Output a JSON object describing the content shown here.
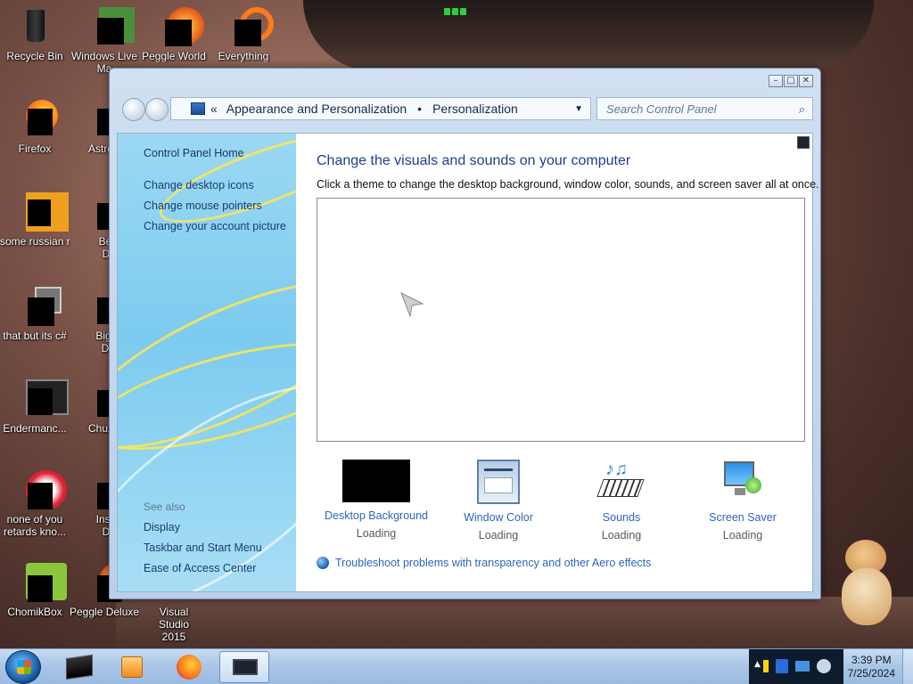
{
  "desktop": {
    "icons": [
      {
        "label": "Recycle Bin",
        "icon": "recycle-bin-icon"
      },
      {
        "label": "Windows Live Ma",
        "icon": "windows-live-icon"
      },
      {
        "label": "Peggle World",
        "icon": "peggle-world-icon"
      },
      {
        "label": "Everything",
        "icon": "everything-icon"
      },
      {
        "label": "Firefox",
        "icon": "firefox-icon"
      },
      {
        "label": "Astro Delu",
        "icon": "astro-icon"
      },
      {
        "label": "some russian ran a rat",
        "icon": "app-icon"
      },
      {
        "label": "Bejew Delu",
        "icon": "bejeweled-icon"
      },
      {
        "label": "that but its c#",
        "icon": "app-icon"
      },
      {
        "label": "Big Mo Delu",
        "icon": "app-icon"
      },
      {
        "label": "Endermanc...",
        "icon": "app-icon"
      },
      {
        "label": "Chuz Delu",
        "icon": "app-icon"
      },
      {
        "label": "none of you retards kno...",
        "icon": "app-icon"
      },
      {
        "label": "Insaniq Delu",
        "icon": "app-icon"
      },
      {
        "label": "ChomikBox",
        "icon": "chomikbox-icon"
      },
      {
        "label": "Peggle Deluxe",
        "icon": "peggle-deluxe-icon"
      },
      {
        "label": "Visual Studio 2015",
        "icon": "visual-studio-icon"
      }
    ]
  },
  "window": {
    "nav": {
      "breadcrumb_sep": "«",
      "crumb1": "Appearance and Personalization",
      "crumb_arrow": "•",
      "crumb2": "Personalization",
      "search_placeholder": "Search Control Panel"
    },
    "caption_buttons": {
      "minimize": "–",
      "maximize": "□",
      "close": "✕"
    },
    "left": {
      "home": "Control Panel Home",
      "links": [
        "Change desktop icons",
        "Change mouse pointers",
        "Change your account picture"
      ],
      "see_also": "See also",
      "see_also_links": [
        "Display",
        "Taskbar and Start Menu",
        "Ease of Access Center"
      ]
    },
    "main": {
      "title": "Change the visuals and sounds on your computer",
      "subtitle": "Click a theme to change the desktop background, window color, sounds, and screen saver all at once.",
      "options": [
        {
          "label": "Desktop Background",
          "status": "Loading"
        },
        {
          "label": "Window Color",
          "status": "Loading"
        },
        {
          "label": "Sounds",
          "status": "Loading"
        },
        {
          "label": "Screen Saver",
          "status": "Loading"
        }
      ],
      "troubleshoot": "Troubleshoot problems with transparency and other Aero effects"
    }
  },
  "taskbar": {
    "time": "3:39 PM",
    "date": "7/25/2024"
  }
}
